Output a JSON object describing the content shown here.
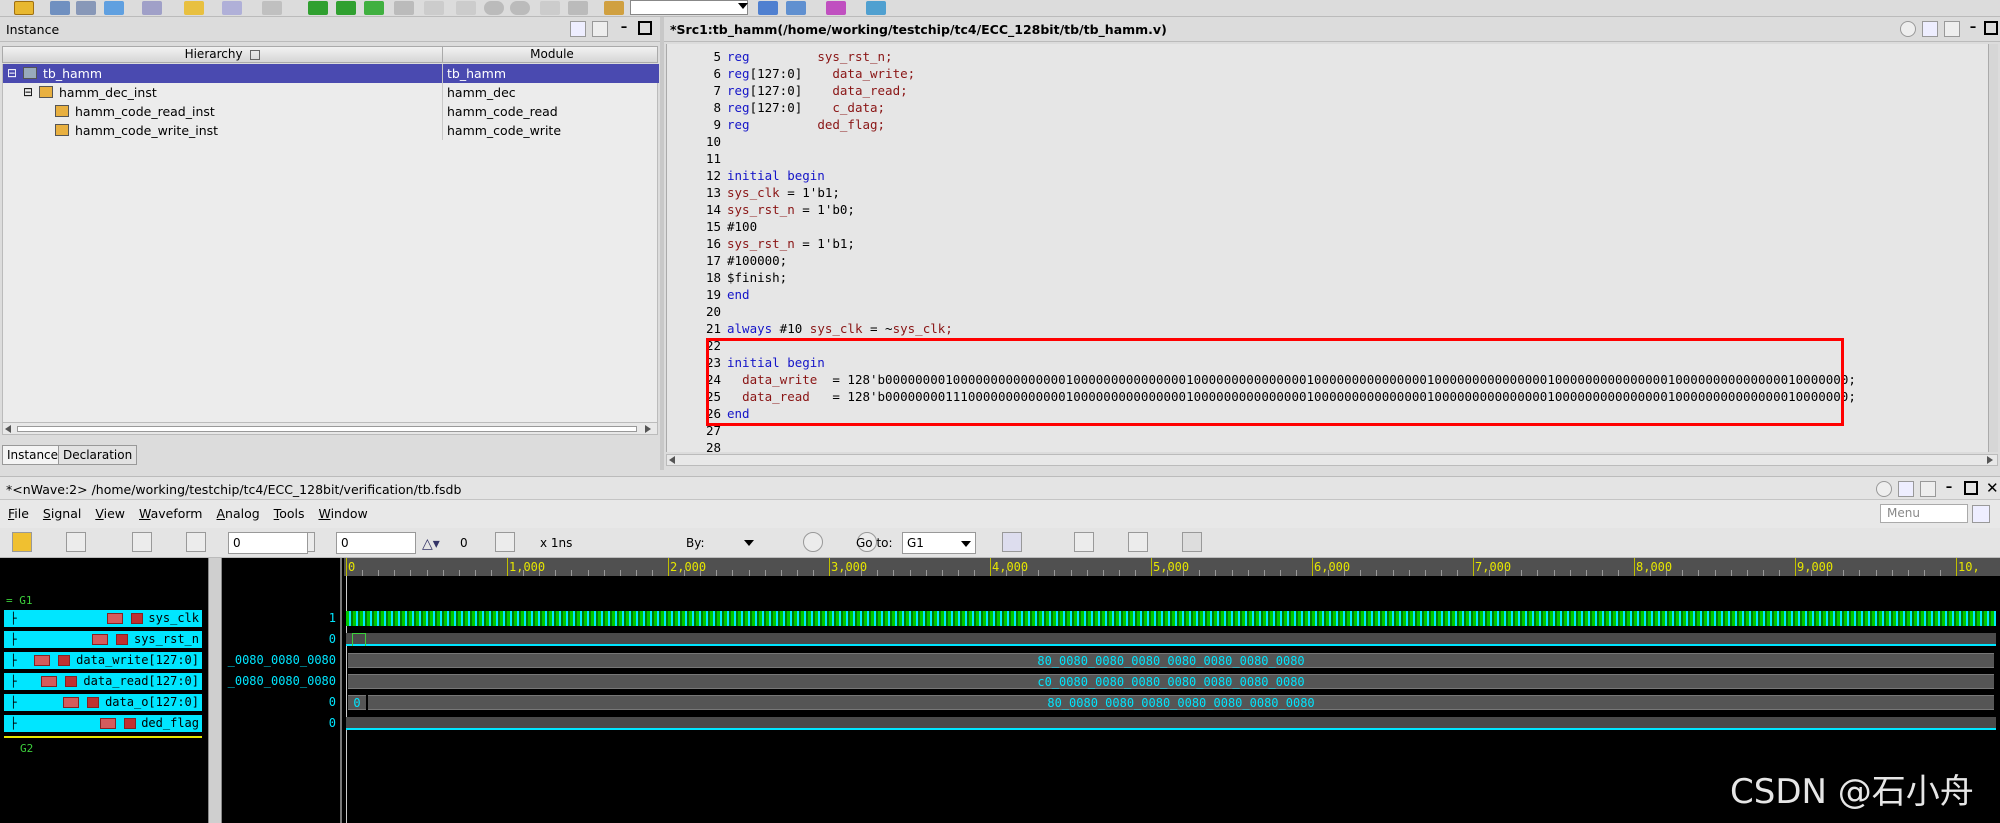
{
  "instance_panel": {
    "title": "Instance",
    "col_hierarchy": "Hierarchy",
    "col_module": "Module",
    "rows": [
      {
        "name": "tb_hamm",
        "module": "tb_hamm",
        "indent": 0,
        "selected": true,
        "toggle": "⊟"
      },
      {
        "name": "hamm_dec_inst",
        "module": "hamm_dec",
        "indent": 1,
        "selected": false,
        "toggle": "⊟"
      },
      {
        "name": "hamm_code_read_inst",
        "module": "hamm_code_read",
        "indent": 2,
        "selected": false,
        "toggle": ""
      },
      {
        "name": "hamm_code_write_inst",
        "module": "hamm_code_write",
        "indent": 2,
        "selected": false,
        "toggle": ""
      }
    ],
    "tabs": [
      "Instance",
      "Declaration"
    ]
  },
  "src_panel": {
    "title": "*Src1:tb_hamm(/home/working/testchip/tc4/ECC_128bit/tb/tb_hamm.v)",
    "lines": [
      {
        "n": "5",
        "segs": [
          [
            "kw",
            "reg"
          ],
          [
            "txt",
            "         "
          ],
          [
            "id",
            "sys_rst_n;"
          ]
        ]
      },
      {
        "n": "6",
        "segs": [
          [
            "kw",
            "reg"
          ],
          [
            "txt",
            "[127:0]    "
          ],
          [
            "id",
            "data_write;"
          ]
        ]
      },
      {
        "n": "7",
        "segs": [
          [
            "kw",
            "reg"
          ],
          [
            "txt",
            "[127:0]    "
          ],
          [
            "id",
            "data_read;"
          ]
        ]
      },
      {
        "n": "8",
        "segs": [
          [
            "kw",
            "reg"
          ],
          [
            "txt",
            "[127:0]    "
          ],
          [
            "id",
            "c_data;"
          ]
        ]
      },
      {
        "n": "9",
        "segs": [
          [
            "kw",
            "reg"
          ],
          [
            "txt",
            "         "
          ],
          [
            "id",
            "ded_flag;"
          ]
        ]
      },
      {
        "n": "10",
        "segs": []
      },
      {
        "n": "11",
        "segs": []
      },
      {
        "n": "12",
        "segs": [
          [
            "kw",
            "initial begin"
          ]
        ]
      },
      {
        "n": "13",
        "segs": [
          [
            "id",
            "sys_clk"
          ],
          [
            "txt",
            " = 1'b1;"
          ]
        ]
      },
      {
        "n": "14",
        "segs": [
          [
            "id",
            "sys_rst_n"
          ],
          [
            "txt",
            " = 1'b0;"
          ]
        ]
      },
      {
        "n": "15",
        "segs": [
          [
            "txt",
            "#100"
          ]
        ]
      },
      {
        "n": "16",
        "segs": [
          [
            "id",
            "sys_rst_n"
          ],
          [
            "txt",
            " = 1'b1;"
          ]
        ]
      },
      {
        "n": "17",
        "segs": [
          [
            "txt",
            "#100000;"
          ]
        ]
      },
      {
        "n": "18",
        "segs": [
          [
            "txt",
            "$finish;"
          ]
        ]
      },
      {
        "n": "19",
        "segs": [
          [
            "kw",
            "end"
          ]
        ]
      },
      {
        "n": "20",
        "segs": []
      },
      {
        "n": "21",
        "segs": [
          [
            "kw",
            "always"
          ],
          [
            "txt",
            " #10 "
          ],
          [
            "id",
            "sys_clk"
          ],
          [
            "txt",
            " = ~"
          ],
          [
            "id",
            "sys_clk;"
          ]
        ]
      },
      {
        "n": "22",
        "segs": []
      },
      {
        "n": "23",
        "segs": [
          [
            "kw",
            "initial begin"
          ]
        ]
      },
      {
        "n": "24",
        "segs": [
          [
            "txt",
            "  "
          ],
          [
            "id",
            "data_write"
          ],
          [
            "txt",
            "  = 128'b00000000100000000000000010000000000000001000000000000000100000000000000010000000000000001000000000000000100000000000000010000000;"
          ]
        ]
      },
      {
        "n": "25",
        "segs": [
          [
            "txt",
            "  "
          ],
          [
            "id",
            "data_read"
          ],
          [
            "txt",
            "   = 128'b00000000111000000000000010000000000000001000000000000000100000000000000010000000000000001000000000000000100000000000000010000000;"
          ]
        ]
      },
      {
        "n": "26",
        "segs": [
          [
            "kw",
            "end"
          ]
        ]
      },
      {
        "n": "27",
        "segs": []
      },
      {
        "n": "28",
        "segs": []
      }
    ]
  },
  "wave_window": {
    "title": "*<nWave:2> /home/working/testchip/tc4/ECC_128bit/verification/tb.fsdb",
    "menu": [
      {
        "label": "File",
        "u": "F",
        "rest": "ile"
      },
      {
        "label": "Signal",
        "u": "S",
        "rest": "ignal"
      },
      {
        "label": "View",
        "u": "V",
        "rest": "iew"
      },
      {
        "label": "Waveform",
        "u": "W",
        "rest": "aveform"
      },
      {
        "label": "Analog",
        "u": "A",
        "rest": "nalog"
      },
      {
        "label": "Tools",
        "u": "T",
        "rest": "ools"
      },
      {
        "label": "Window",
        "u": "W",
        "rest": "indow"
      }
    ],
    "menu_search_placeholder": "Menu",
    "toolbar": {
      "cursor_time": "0",
      "marker_time": "0",
      "delta": "0",
      "unit": "x 1ns",
      "by_label": "By:",
      "goto_label": "Go to:",
      "goto_value": "G1"
    },
    "ruler_labels": [
      "0",
      "1,000",
      "2,000",
      "3,000",
      "4,000",
      "5,000",
      "6,000",
      "7,000",
      "8,000",
      "9,000",
      "10,"
    ],
    "group1": "= G1",
    "group2": "G2",
    "signals": [
      {
        "name": "sys_clk",
        "value": "1",
        "bus_text": ""
      },
      {
        "name": "sys_rst_n",
        "value": "0",
        "bus_text": ""
      },
      {
        "name": "data_write[127:0]",
        "value": "_0080_0080_0080",
        "bus_text": "80_0080_0080_0080_0080_0080_0080_0080"
      },
      {
        "name": "data_read[127:0]",
        "value": "_0080_0080_0080",
        "bus_text": "c0_0080_0080_0080_0080_0080_0080_0080"
      },
      {
        "name": "data_o[127:0]",
        "value": "0",
        "bus_text": "80_0080_0080_0080_0080_0080_0080_0080",
        "first_seg": "0"
      },
      {
        "name": "ded_flag",
        "value": "0",
        "bus_text": ""
      }
    ]
  },
  "watermark": "CSDN @石小舟",
  "colors": {
    "selection": "#4a4ab0",
    "wave_bg": "#000000",
    "signal_cyan": "#00e6ff",
    "clk_green": "#00c800",
    "highlight_red": "#ff0000"
  }
}
